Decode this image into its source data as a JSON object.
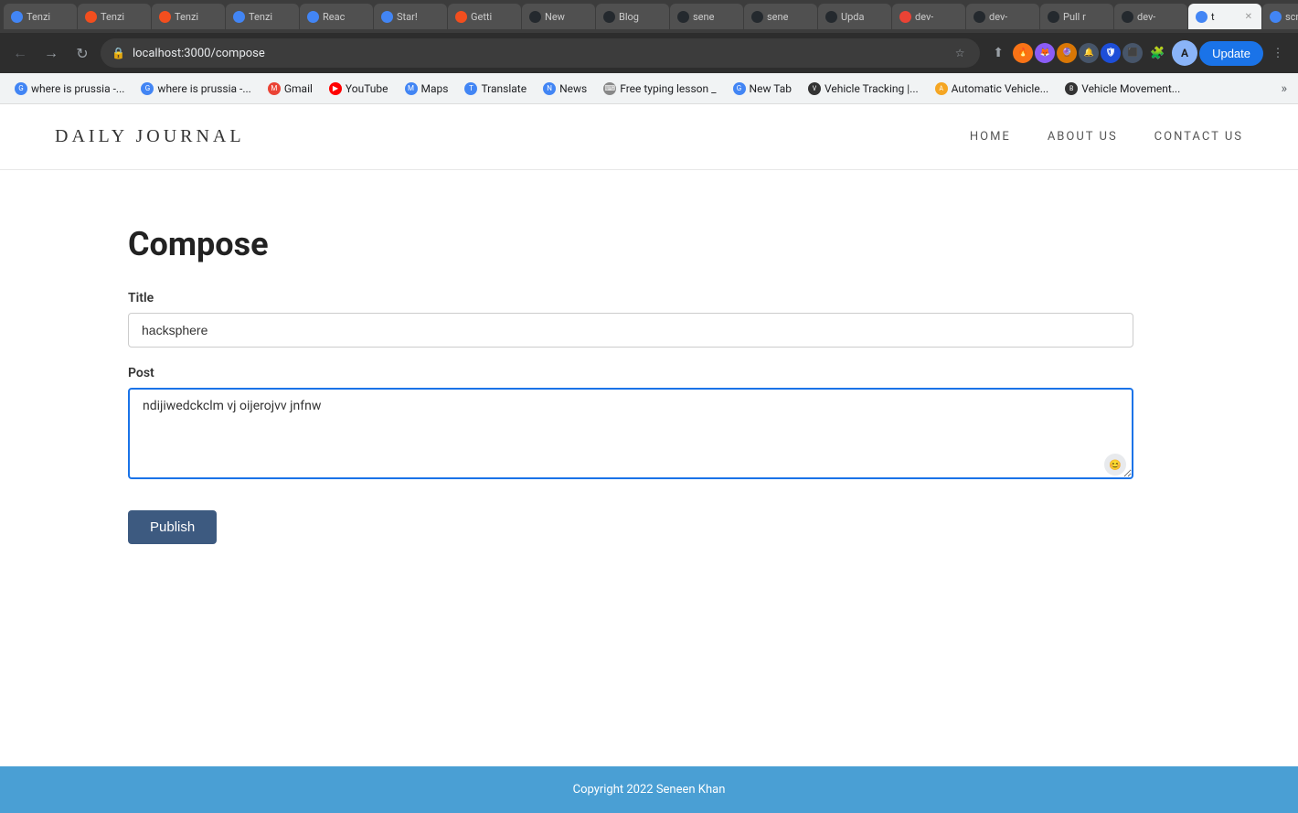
{
  "browser": {
    "tabs": [
      {
        "id": 1,
        "label": "Tenzi",
        "icon_type": "google",
        "icon_color": "#4285f4",
        "active": false
      },
      {
        "id": 2,
        "label": "Tenzi",
        "icon_type": "figma",
        "icon_color": "#f24e1e",
        "active": false
      },
      {
        "id": 3,
        "label": "Tenzi",
        "icon_type": "figma",
        "icon_color": "#f24e1e",
        "active": false
      },
      {
        "id": 4,
        "label": "Tenzi",
        "icon_type": "google",
        "icon_color": "#4285f4",
        "active": false
      },
      {
        "id": 5,
        "label": "Reac",
        "icon_type": "google",
        "icon_color": "#4285f4",
        "active": false
      },
      {
        "id": 6,
        "label": "Star!",
        "icon_type": "google",
        "icon_color": "#4285f4",
        "active": false
      },
      {
        "id": 7,
        "label": "Getti",
        "icon_type": "github",
        "icon_color": "#24292e",
        "active": false
      },
      {
        "id": 8,
        "label": "New",
        "icon_type": "github",
        "icon_color": "#24292e",
        "active": false
      },
      {
        "id": 9,
        "label": "Blog",
        "icon_type": "github",
        "icon_color": "#24292e",
        "active": false
      },
      {
        "id": 10,
        "label": "sene",
        "icon_type": "github",
        "icon_color": "#24292e",
        "active": false
      },
      {
        "id": 11,
        "label": "sene",
        "icon_type": "github",
        "icon_color": "#24292e",
        "active": false
      },
      {
        "id": 12,
        "label": "Upda",
        "icon_type": "github",
        "icon_color": "#24292e",
        "active": false
      },
      {
        "id": 13,
        "label": "dev-",
        "icon_type": "gmail",
        "icon_color": "#ea4335",
        "active": false
      },
      {
        "id": 14,
        "label": "dev-",
        "icon_type": "github",
        "icon_color": "#24292e",
        "active": false
      },
      {
        "id": 15,
        "label": "Pull r",
        "icon_type": "github",
        "icon_color": "#24292e",
        "active": false
      },
      {
        "id": 16,
        "label": "dev-",
        "icon_type": "github",
        "icon_color": "#24292e",
        "active": false
      },
      {
        "id": 17,
        "label": "t",
        "icon_type": "chrome",
        "icon_color": "#4285f4",
        "active": true
      },
      {
        "id": 18,
        "label": "scree",
        "icon_type": "google",
        "icon_color": "#4285f4",
        "active": false
      }
    ],
    "address": "localhost:3000/compose",
    "update_button_label": "Update"
  },
  "bookmarks": [
    {
      "label": "where is prussia -...",
      "icon_color": "#4285f4",
      "icon_text": "G"
    },
    {
      "label": "where is prussia -...",
      "icon_color": "#4285f4",
      "icon_text": "G"
    },
    {
      "label": "Gmail",
      "icon_color": "#ea4335",
      "icon_text": "M"
    },
    {
      "label": "YouTube",
      "icon_color": "#ff0000",
      "icon_text": "▶"
    },
    {
      "label": "Maps",
      "icon_color": "#4285f4",
      "icon_text": "M"
    },
    {
      "label": "Translate",
      "icon_color": "#4285f4",
      "icon_text": "T"
    },
    {
      "label": "News",
      "icon_color": "#4285f4",
      "icon_text": "N"
    },
    {
      "label": "Free typing lesson _",
      "icon_color": "#888",
      "icon_text": "⌨"
    },
    {
      "label": "New Tab",
      "icon_color": "#4285f4",
      "icon_text": "G"
    },
    {
      "label": "Vehicle Tracking |...",
      "icon_color": "#333",
      "icon_text": "V"
    },
    {
      "label": "Automatic Vehicle...",
      "icon_color": "#f5a623",
      "icon_text": "A"
    },
    {
      "label": "Vehicle Movement...",
      "icon_color": "#333",
      "icon_text": "B"
    }
  ],
  "site": {
    "logo": "DAILY JOURNAL",
    "nav": {
      "items": [
        {
          "label": "HOME"
        },
        {
          "label": "ABOUT US"
        },
        {
          "label": "CONTACT US"
        }
      ]
    },
    "page_title": "Compose",
    "form": {
      "title_label": "Title",
      "title_value": "hacksphere",
      "post_label": "Post",
      "post_value": "ndijiwedckclm vj oijerojvv jnfnw",
      "publish_label": "Publish"
    },
    "footer": {
      "text": "Copyright 2022 Seneen Khan"
    }
  }
}
